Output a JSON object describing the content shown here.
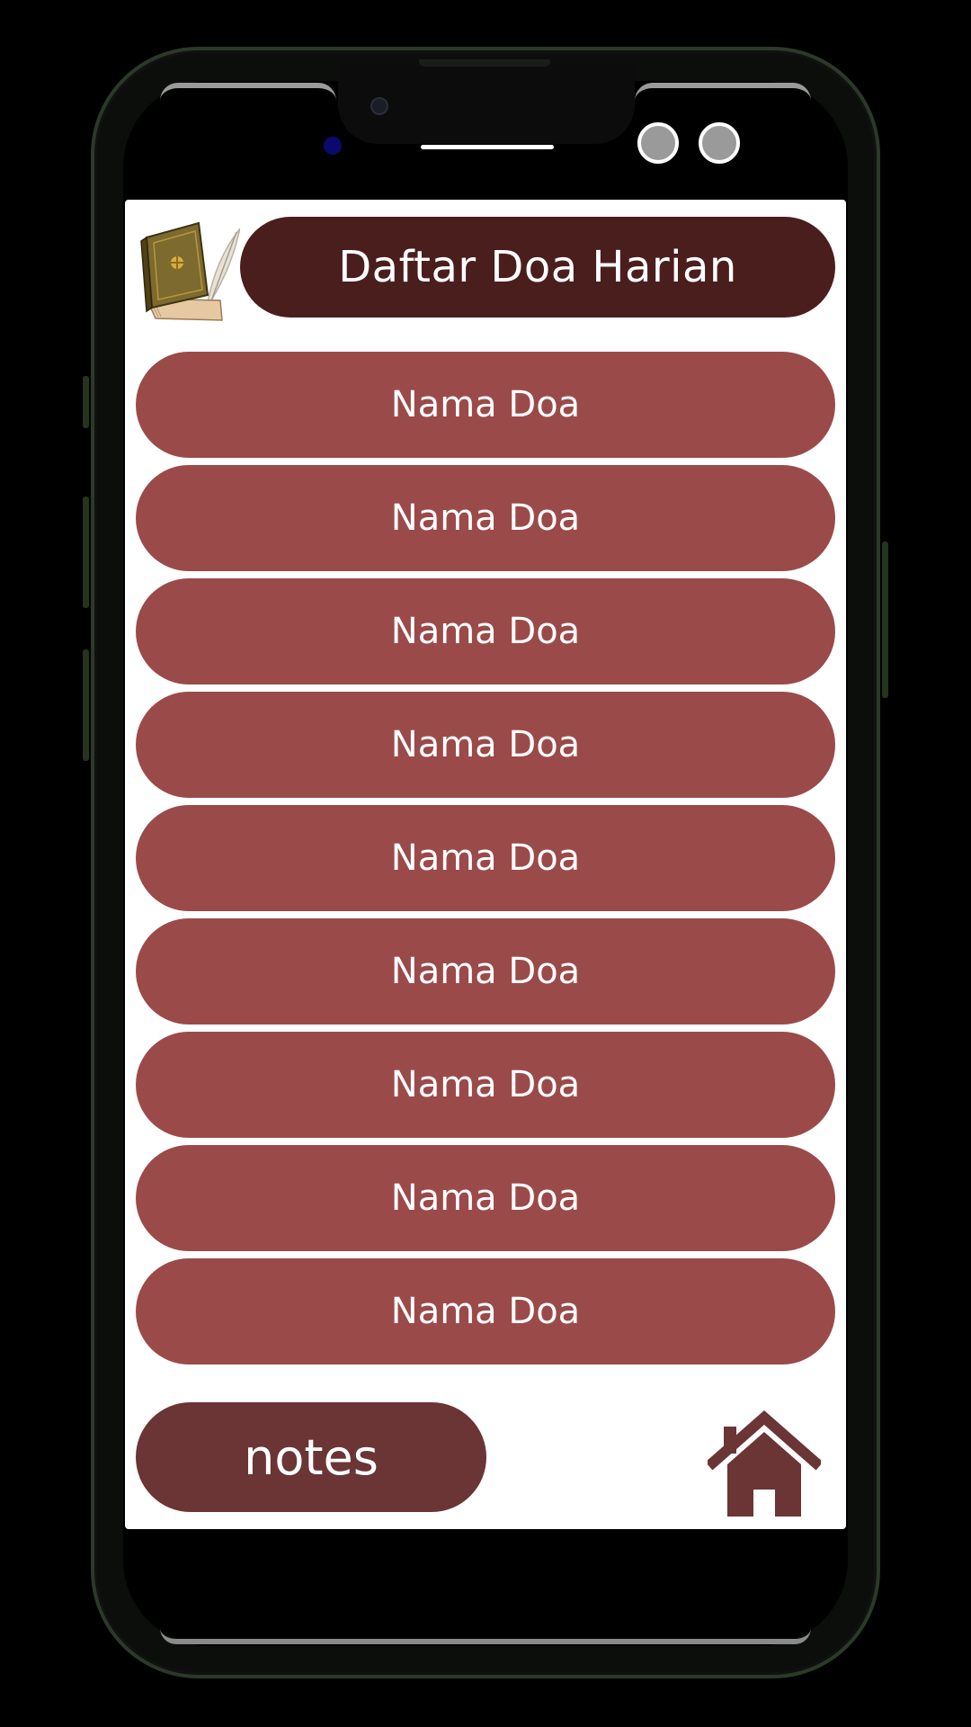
{
  "app": {
    "title": "Daftar Doa Harian",
    "logo_icon": "book-quill-icon"
  },
  "list": {
    "items": [
      {
        "label": "Nama Doa"
      },
      {
        "label": "Nama Doa"
      },
      {
        "label": "Nama Doa"
      },
      {
        "label": "Nama Doa"
      },
      {
        "label": "Nama Doa"
      },
      {
        "label": "Nama Doa"
      },
      {
        "label": "Nama Doa"
      },
      {
        "label": "Nama Doa"
      },
      {
        "label": "Nama Doa"
      }
    ]
  },
  "footer": {
    "notes_label": "notes",
    "home_icon": "home-icon"
  },
  "colors": {
    "background": "#000000",
    "screen": "#ffffff",
    "title_bar": "#4b1e1e",
    "list_item": "#9b4a4a",
    "notes_button": "#6b3535",
    "home_icon": "#6b3535",
    "frame": "#2b3a28"
  }
}
